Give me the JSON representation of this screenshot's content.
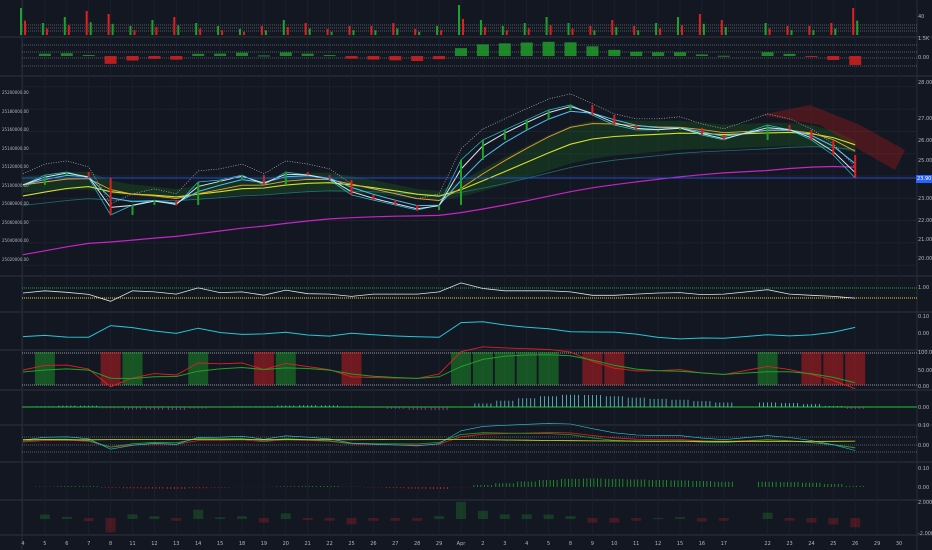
{
  "chart_data": {
    "type": "line",
    "title": "",
    "xlabel": "",
    "ylabel": "",
    "ylim": [
      19.6,
      28.4
    ],
    "last_price_label": "23.90",
    "dates": [
      "4",
      "5",
      "6",
      "7",
      "8",
      "11",
      "12",
      "13",
      "14",
      "15",
      "18",
      "19",
      "20",
      "21",
      "22",
      "25",
      "26",
      "27",
      "28",
      "29",
      "Apr",
      "2",
      "3",
      "4",
      "5",
      "8",
      "9",
      "10",
      "11",
      "12",
      "15",
      "16",
      "17",
      "22",
      "23",
      "24",
      "25",
      "26",
      "29",
      "30"
    ],
    "trading_day_index": [
      0,
      1,
      2,
      3,
      4,
      5,
      6,
      7,
      8,
      9,
      10,
      11,
      12,
      13,
      14,
      15,
      16,
      17,
      18,
      19,
      20,
      21,
      22,
      23,
      24,
      25,
      26,
      27,
      28,
      29,
      30,
      31,
      32,
      34,
      35,
      36,
      37,
      38,
      39,
      40
    ],
    "series": [
      {
        "name": "Price",
        "color": "#e0e3eb",
        "values": [
          23.6,
          24.04,
          24.18,
          23.91,
          22.25,
          22.7,
          22.92,
          22.7,
          23.73,
          23.82,
          24.04,
          23.6,
          24.18,
          24.04,
          23.82,
          23.15,
          22.92,
          22.7,
          22.47,
          22.7,
          24.72,
          25.62,
          26.07,
          26.52,
          26.96,
          27.19,
          26.74,
          26.29,
          26.07,
          26.07,
          26.16,
          25.84,
          25.62,
          26.29,
          26.07,
          25.62,
          24.94,
          23.91
        ]
      },
      {
        "name": "Volume",
        "values": [
          9,
          4,
          6,
          8,
          7,
          3,
          5,
          6,
          4,
          3,
          2,
          3,
          5,
          4,
          2,
          3,
          3,
          4,
          2,
          3,
          10,
          5,
          3,
          4,
          6,
          4,
          3,
          5,
          3,
          4,
          6,
          7,
          5,
          4,
          3,
          3,
          4,
          9
        ]
      }
    ],
    "right_axis": {
      "pane_volume": [
        "40",
        "1.5K"
      ],
      "pane_delta": [
        "0.00"
      ],
      "main": [
        "28.00",
        "27.00",
        "26.00",
        "25.00",
        "23.00",
        "22.00",
        "21.00",
        "20.00"
      ],
      "pane_rsi": [
        "1.00"
      ],
      "pane_volatility": [
        "0.10",
        "0.00"
      ],
      "pane_stoch": [
        "100.00",
        "50.00",
        "0.00"
      ],
      "pane_macd": [
        "0.00",
        "0.10"
      ],
      "pane_osc": [
        "0.00"
      ],
      "pane_hist": [
        "0.10",
        "0.00"
      ],
      "pane_bottom": [
        "2.0000",
        "-2.0000"
      ]
    },
    "left_axis": [
      "25200000.00",
      "25180000.00",
      "25160000.00",
      "25140000.00",
      "25120000.00",
      "25100000.00",
      "25080000.00",
      "25060000.00",
      "25040000.00",
      "25020000.00"
    ],
    "colors": {
      "up": "#26a69a",
      "green": "#1fa22a",
      "red": "#e0201f",
      "ma_yellow": "#d4e02a",
      "ma_orange": "#f0a030",
      "ma_blue": "#4fc3f7",
      "ma_purple": "#c425c4",
      "cyan": "#26c6da",
      "price_line": "#2962ff"
    }
  }
}
